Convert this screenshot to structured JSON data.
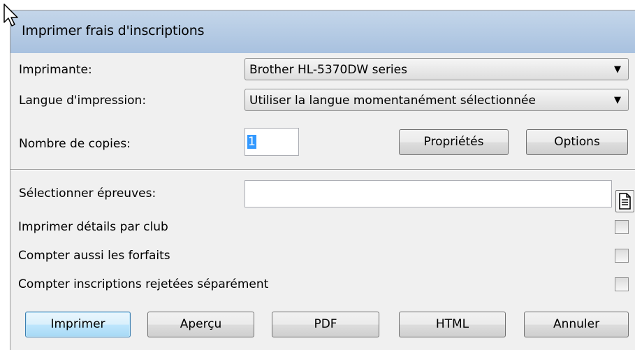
{
  "window": {
    "title": "Imprimer frais d'inscriptions"
  },
  "form": {
    "printer_label": "Imprimante:",
    "printer_value": "Brother HL-5370DW series",
    "language_label": "Langue d'impression:",
    "language_value": "Utiliser la langue momentanément sélectionnée",
    "copies_label": "Nombre de copies:",
    "copies_value": "1",
    "properties_button": "Propriétés",
    "options_button": "Options",
    "events_label": "Sélectionner épreuves:",
    "events_value": "",
    "checkboxes": [
      {
        "label": "Imprimer détails par club",
        "checked": false
      },
      {
        "label": "Compter aussi les forfaits",
        "checked": false
      },
      {
        "label": "Compter inscriptions rejetées séparément",
        "checked": false
      }
    ]
  },
  "footer": {
    "print_button": "Imprimer",
    "preview_button": "Aperçu",
    "pdf_button": "PDF",
    "html_button": "HTML",
    "cancel_button": "Annuler"
  },
  "icons": {
    "dropdown": "chevron-down-icon",
    "file_picker": "document-icon",
    "cursor": "mouse-pointer-icon"
  }
}
